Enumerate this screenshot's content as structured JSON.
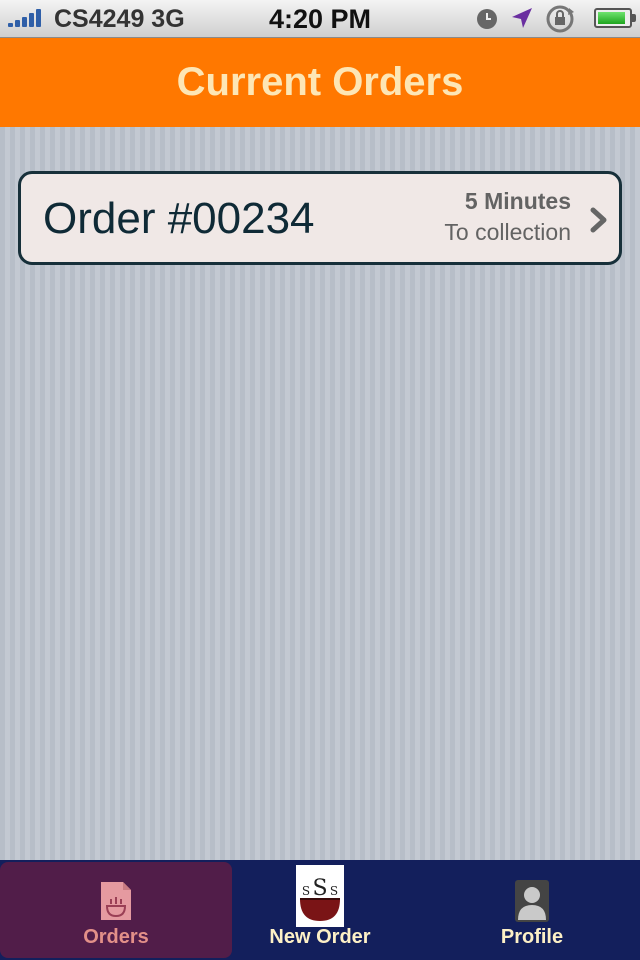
{
  "status_bar": {
    "carrier": "CS4249 3G",
    "time": "4:20 PM",
    "icons": [
      "signal-icon",
      "clock-icon",
      "location-arrow-icon",
      "rotation-lock-icon",
      "battery-icon"
    ]
  },
  "header": {
    "title": "Current Orders"
  },
  "orders": [
    {
      "title": "Order #00234",
      "minutes": "5 Minutes",
      "status": "To collection"
    }
  ],
  "tab_bar": {
    "tabs": [
      {
        "label": "Orders",
        "icon": "orders-icon",
        "active": true
      },
      {
        "label": "New Order",
        "icon": "new-order-bowl-icon",
        "active": false
      },
      {
        "label": "Profile",
        "icon": "profile-icon",
        "active": false
      }
    ]
  },
  "colors": {
    "header": "#ff7800",
    "header_text": "#fde6b5",
    "tab_bar": "#131f5c",
    "active_tab": "#511d49"
  }
}
